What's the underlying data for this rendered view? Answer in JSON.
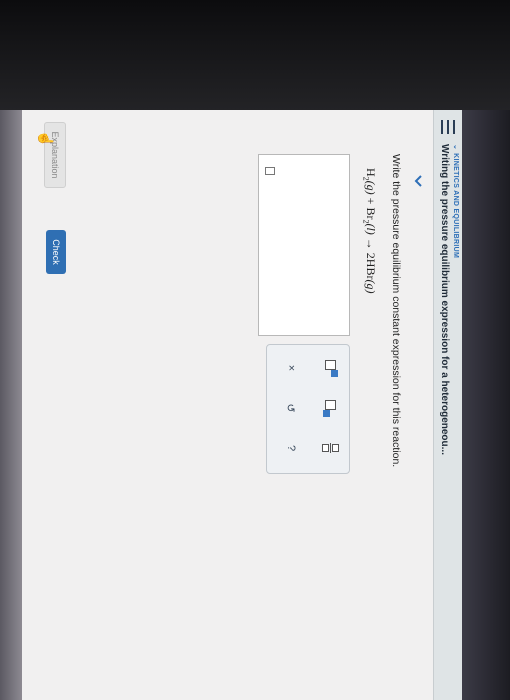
{
  "header": {
    "topic": "KINETICS AND EQUILIBRIUM",
    "title": "Writing the pressure equilibrium expression for a heterogeneou..."
  },
  "question": {
    "prompt": "Write the pressure equilibrium constant expression for this reaction.",
    "equation": {
      "r1": "H",
      "r1_sub": "2",
      "r1_state": "(g)",
      "plus": "+",
      "r2": "Br",
      "r2_sub": "2",
      "r2_state": "(l)",
      "arrow": "→",
      "product": "2HBr",
      "product_state": "(g)"
    }
  },
  "palette": {
    "clear": "×",
    "undo": "↺",
    "help": "?"
  },
  "footer": {
    "explanation": "Explanation",
    "check": "Check"
  }
}
